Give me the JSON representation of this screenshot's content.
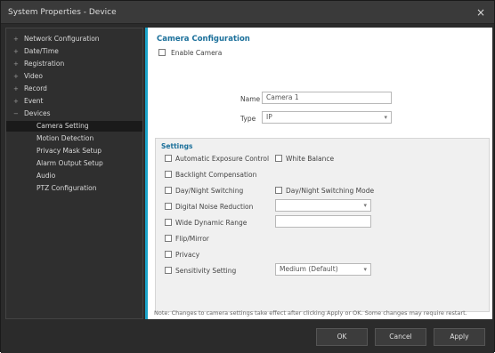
{
  "window": {
    "title": "System Properties - Device",
    "close_glyph": "×"
  },
  "sidebar": {
    "items": [
      {
        "label": "Network Configuration",
        "expander": "+",
        "child": false
      },
      {
        "label": "Date/Time",
        "expander": "+",
        "child": false
      },
      {
        "label": "Registration",
        "expander": "+",
        "child": false
      },
      {
        "label": "Video",
        "expander": "+",
        "child": false
      },
      {
        "label": "Record",
        "expander": "+",
        "child": false
      },
      {
        "label": "Event",
        "expander": "+",
        "child": false
      },
      {
        "label": "Devices",
        "expander": "−",
        "child": false
      },
      {
        "label": "Camera Setting",
        "expander": "",
        "child": true,
        "selected": true
      },
      {
        "label": "Motion Detection",
        "expander": "",
        "child": true
      },
      {
        "label": "Privacy Mask Setup",
        "expander": "",
        "child": true
      },
      {
        "label": "Alarm Output Setup",
        "expander": "",
        "child": true
      },
      {
        "label": "Audio",
        "expander": "",
        "child": true
      },
      {
        "label": "PTZ Configuration",
        "expander": "",
        "child": true
      }
    ]
  },
  "content": {
    "title": "Camera Configuration",
    "enable_label": "Enable Camera",
    "name_label": "Name",
    "name_value": "Camera 1",
    "type_label": "Type",
    "type_value": "IP",
    "group_title": "Settings",
    "options": [
      {
        "label": "Automatic Exposure Control",
        "col": 0
      },
      {
        "label": "White Balance",
        "col": 1
      },
      {
        "label": "Backlight Compensation",
        "col": 0
      },
      {
        "label": "Day/Night Switching",
        "col": 0
      },
      {
        "label": "Day/Night Switching Mode",
        "col": 1
      },
      {
        "label": "Digital Noise Reduction",
        "col": 0
      },
      {
        "label": "Wide Dynamic Range",
        "col": 0
      },
      {
        "label": "Flip/Mirror",
        "col": 0
      },
      {
        "label": "Privacy",
        "col": 0
      },
      {
        "label": "Sensitivity Setting",
        "col": 0
      }
    ],
    "dnr_select": "",
    "wdr_input": "",
    "sensitivity_select": "Medium (Default)",
    "footer_note": "Note: Changes to camera settings take effect after clicking Apply or OK. Some changes may require restart."
  },
  "buttons": {
    "ok": "OK",
    "cancel": "Cancel",
    "apply": "Apply"
  }
}
